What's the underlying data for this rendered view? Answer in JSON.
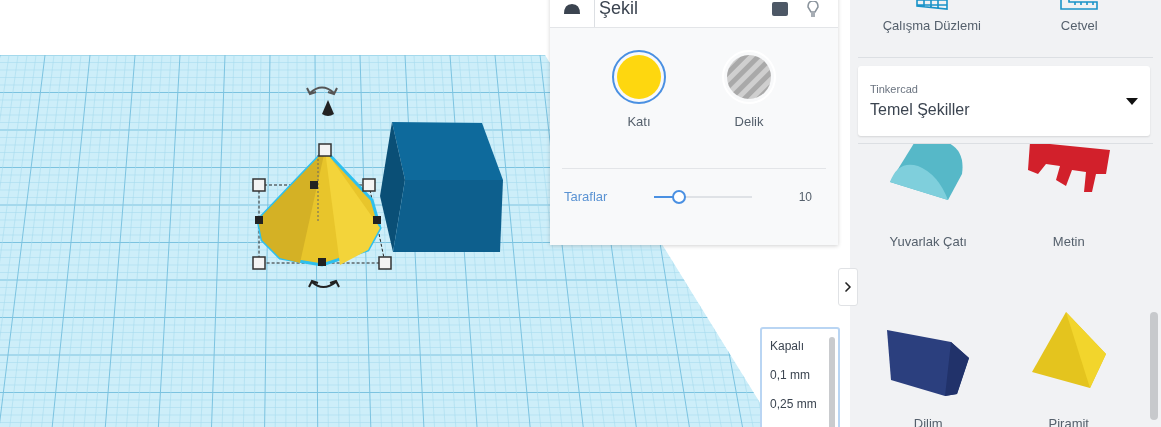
{
  "inspector": {
    "title": "Şekil",
    "options": [
      {
        "label": "Katı",
        "kind": "solid",
        "selected": true
      },
      {
        "label": "Delik",
        "kind": "hole",
        "selected": false
      }
    ],
    "slider": {
      "label": "Taraflar",
      "level": 0.26,
      "reading": "10"
    }
  },
  "snap_grid": {
    "options": [
      "Kapalı",
      "0,1 mm",
      "0,25 mm"
    ]
  },
  "sidebar": {
    "tools": [
      {
        "label": "Çalışma Düzlemi",
        "kind": "workplane"
      },
      {
        "label": "Cetvel",
        "kind": "ruler"
      }
    ],
    "library": {
      "label": "Tinkercad",
      "value": "Temel Şekiller"
    },
    "shapes": [
      {
        "label": "Yuvarlak Çatı",
        "kind": "roof"
      },
      {
        "label": "Metin",
        "kind": "text"
      },
      {
        "label": "Dilim",
        "kind": "wedge"
      },
      {
        "label": "Piramit",
        "kind": "pyramid"
      }
    ]
  }
}
